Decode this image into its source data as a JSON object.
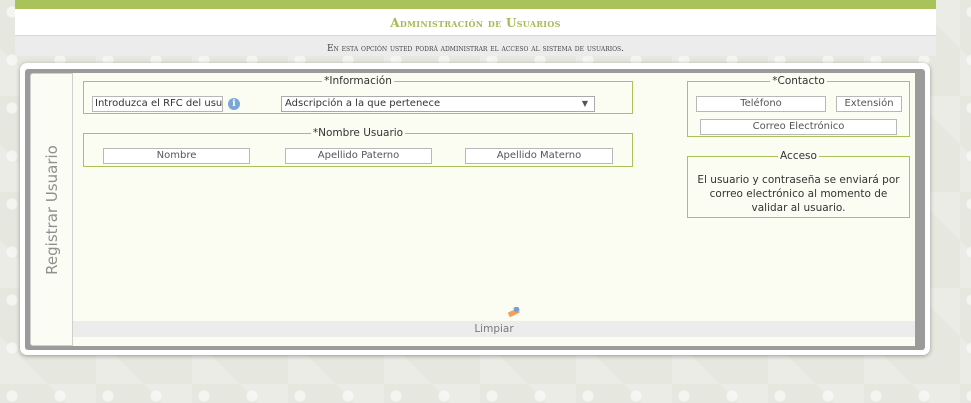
{
  "header": {
    "title": "Administración de Usuarios",
    "subtitle": "En esta opción usted podrá administrar el acceso al sistema de usuarios."
  },
  "side_tab": {
    "label": "Registrar Usuario"
  },
  "info_section": {
    "legend": "*Información",
    "rfc_value": "Introduzca el RFC del usuari",
    "adscripcion_selected": "Adscripción a la que pertenece"
  },
  "name_section": {
    "legend": "*Nombre Usuario",
    "nombre_placeholder": "Nombre",
    "paterno_placeholder": "Apellido Paterno",
    "materno_placeholder": "Apellido Materno"
  },
  "contact_section": {
    "legend": "*Contacto",
    "telefono_placeholder": "Teléfono",
    "extension_placeholder": "Extensión",
    "correo_placeholder": "Correo Electrónico"
  },
  "access_section": {
    "legend": "Acceso",
    "text": "El usuario y contraseña se enviará por correo electrónico al momento de validar al usuario."
  },
  "actions": {
    "clear_label": "Limpiar"
  },
  "icons": {
    "info": "info-icon",
    "eraser": "eraser-icon",
    "dropdown": "chevron-down-icon"
  },
  "colors": {
    "accent": "#a9c25a",
    "title": "#a7ba56",
    "content_bg": "#fbfdf2"
  }
}
